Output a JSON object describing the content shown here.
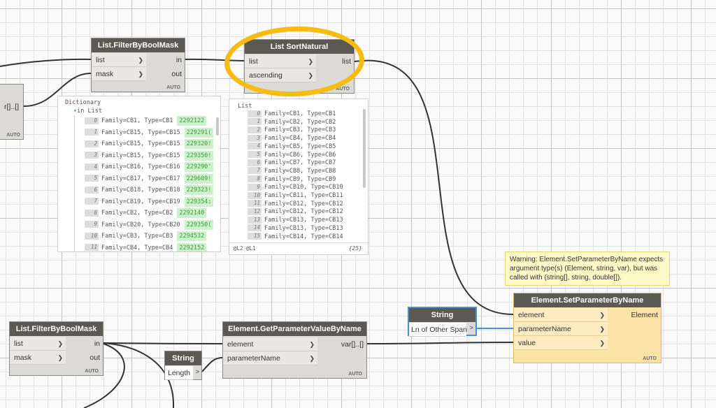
{
  "colors": {
    "wire": "#333333",
    "selected_wire": "#4a8fcf",
    "highlight": "#f7bc12",
    "warning_node": "#fbe3a8"
  },
  "nodes": {
    "filter_top": {
      "title": "List.FilterByBoolMask",
      "inputs": [
        "list",
        "mask"
      ],
      "outputs": [
        "in",
        "out"
      ],
      "lacing": "AUTO"
    },
    "left_partial": {
      "output": "r[]..[]",
      "lacing": "AUTO"
    },
    "sort_natural": {
      "title": "List SortNatural",
      "inputs": [
        "list",
        "ascending"
      ],
      "outputs": [
        "list"
      ],
      "lacing": "AUTO"
    },
    "filter_bottom": {
      "title": "List.FilterByBoolMask",
      "inputs": [
        "list",
        "mask"
      ],
      "outputs": [
        "in",
        "out"
      ],
      "lacing": "AUTO"
    },
    "string_length": {
      "title": "String",
      "value": "Length"
    },
    "get_param": {
      "title": "Element.GetParameterValueByName",
      "inputs": [
        "element",
        "parameterName"
      ],
      "outputs": [
        "var[]..[]"
      ],
      "lacing": "AUTO"
    },
    "string_span": {
      "title": "String",
      "value": "Ln of Other Span"
    },
    "set_param": {
      "title": "Element.SetParameterByName",
      "inputs": [
        "element",
        "parameterName",
        "value"
      ],
      "outputs": [
        "Element"
      ],
      "lacing": "AUTO"
    }
  },
  "warning": "Warning: Element.SetParameterByName expects argument type(s) (Element, string, var), but was called with (string[], string, double[]).",
  "dict_preview": {
    "header": "Dictionary",
    "sub": "in",
    "sublist": "List",
    "rows": [
      {
        "i": "0",
        "text": "Family=CB1, Type=CB1",
        "id": "2292122"
      },
      {
        "i": "1",
        "text": "Family=CB15, Type=CB15",
        "id": "229291("
      },
      {
        "i": "2",
        "text": "Family=CB15, Type=CB15",
        "id": "229320!"
      },
      {
        "i": "3",
        "text": "Family=CB15, Type=CB15",
        "id": "229350!"
      },
      {
        "i": "4",
        "text": "Family=CB16, Type=CB16",
        "id": "229290'"
      },
      {
        "i": "5",
        "text": "Family=CB17, Type=CB17",
        "id": "229609!"
      },
      {
        "i": "6",
        "text": "Family=CB18, Type=CB18",
        "id": "229323!"
      },
      {
        "i": "7",
        "text": "Family=CB19, Type=CB19",
        "id": "229354:"
      },
      {
        "i": "8",
        "text": "Family=CB2, Type=CB2",
        "id": "2292140"
      },
      {
        "i": "9",
        "text": "Family=CB20, Type=CB20",
        "id": "229350("
      },
      {
        "i": "10",
        "text": "Family=CB3, Type=CB3",
        "id": "2294532"
      },
      {
        "i": "11",
        "text": "Family=CB4, Type=CB4",
        "id": "2292152"
      }
    ]
  },
  "sort_preview": {
    "header": "List",
    "footer_left": "@L2 @L1",
    "footer_right": "{25}",
    "rows": [
      {
        "i": "0",
        "text": "Family=CB1, Type=CB1"
      },
      {
        "i": "1",
        "text": "Family=CB2, Type=CB2"
      },
      {
        "i": "2",
        "text": "Family=CB3, Type=CB3"
      },
      {
        "i": "3",
        "text": "Family=CB4, Type=CB4"
      },
      {
        "i": "4",
        "text": "Family=CB5, Type=CB5"
      },
      {
        "i": "5",
        "text": "Family=CB6, Type=CB6"
      },
      {
        "i": "6",
        "text": "Family=CB7, Type=CB7"
      },
      {
        "i": "7",
        "text": "Family=CB8, Type=CB8"
      },
      {
        "i": "8",
        "text": "Family=CB9, Type=CB9"
      },
      {
        "i": "9",
        "text": "Family=CB10, Type=CB10"
      },
      {
        "i": "10",
        "text": "Family=CB11, Type=CB11"
      },
      {
        "i": "11",
        "text": "Family=CB12, Type=CB12"
      },
      {
        "i": "12",
        "text": "Family=CB12, Type=CB12"
      },
      {
        "i": "13",
        "text": "Family=CB13, Type=CB13"
      },
      {
        "i": "14",
        "text": "Family=CB13, Type=CB13"
      },
      {
        "i": "15",
        "text": "Family=CB14, Type=CB14"
      }
    ]
  }
}
